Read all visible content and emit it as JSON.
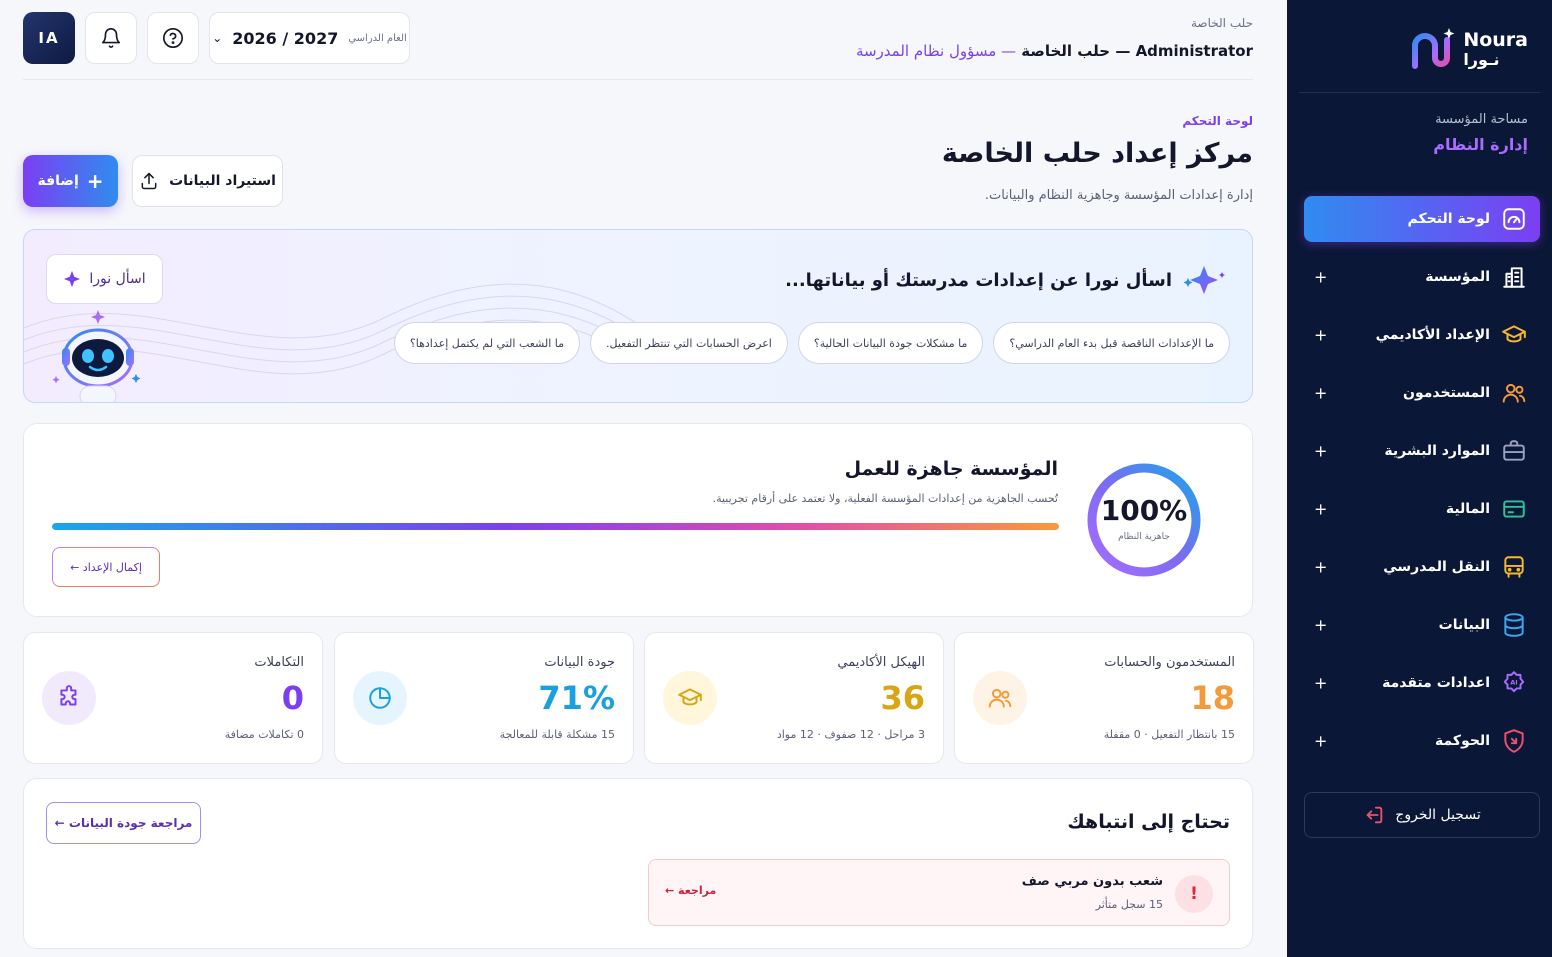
{
  "brand": {
    "name_en": "Noura",
    "name_ar": "نـورا"
  },
  "sidebar": {
    "workspace_label": "مساحة المؤسسة",
    "workspace_value": "إدارة النظام",
    "items": [
      {
        "label": "لوحة التحكم",
        "icon": "dashboard-gauge-icon",
        "color": "#ffffff",
        "active": true
      },
      {
        "label": "المؤسسة",
        "icon": "building-icon",
        "color": "#ffffff",
        "plus": "+"
      },
      {
        "label": "الإعداد الأكاديمي",
        "icon": "graduation-cap-icon",
        "color": "#f5b92a",
        "plus": "+"
      },
      {
        "label": "المستخدمون",
        "icon": "users-icon",
        "color": "#f59a3a",
        "plus": "+"
      },
      {
        "label": "الموارد البشرية",
        "icon": "briefcase-icon",
        "color": "#9aa3bd",
        "plus": "+"
      },
      {
        "label": "المالية",
        "icon": "credit-card-icon",
        "color": "#2fc39a",
        "plus": "+"
      },
      {
        "label": "النقل المدرسي",
        "icon": "bus-icon",
        "color": "#f5b92a",
        "plus": "+"
      },
      {
        "label": "البيانات",
        "icon": "database-icon",
        "color": "#3aa7f0",
        "plus": "+"
      },
      {
        "label": "اعدادات متقدمة",
        "icon": "ai-badge-icon",
        "color": "#a86cff",
        "plus": "+"
      },
      {
        "label": "الحوكمة",
        "icon": "shield-icon",
        "color": "#f0506e",
        "plus": "+"
      }
    ],
    "logout_label": "تسجيل الخروج"
  },
  "topbar": {
    "avatar_initials": "IA",
    "year_label": "العام الدراسي",
    "year_value": "2026 / 2027",
    "org_small": "حلب الخاصة",
    "org_name": "Administrator — حلب الخاصة",
    "org_role": "— مسؤول نظام المدرسة"
  },
  "page": {
    "breadcrumb": "لوحة التحكم",
    "title": "مركز إعداد حلب الخاصة",
    "subtitle": "إدارة إعدادات المؤسسة وجاهزية النظام والبيانات.",
    "add_label": "إضافة",
    "import_label": "استيراد البيانات"
  },
  "ask": {
    "title": "اسأل نورا عن إعدادات مدرستك أو بياناتها...",
    "button_label": "اسأل نورا",
    "chips": [
      "ما الإعدادات الناقصة قبل بدء العام الدراسي؟",
      "ما مشكلات جودة البيانات الحالية؟",
      "اعرض الحسابات التي تنتظر التفعيل.",
      "ما الشعب التي لم يكتمل إعدادها؟"
    ]
  },
  "readiness": {
    "percent_text": "100%",
    "percent_value": 100,
    "ring_label": "جاهزية النظام",
    "title": "المؤسسة جاهزة للعمل",
    "subtitle": "تُحسب الجاهزية من إعدادات المؤسسة الفعلية، ولا تعتمد على أرقام تجريبية.",
    "progress_value": 1.0,
    "button_label": "إكمال الإعداد ←"
  },
  "stats": [
    {
      "title": "المستخدمون والحسابات",
      "value": "18",
      "note": "15 بانتظار التفعيل · 0 مقفلة",
      "color": "#f59a3a",
      "bg": "#fff3e6",
      "icon": "users-icon"
    },
    {
      "title": "الهيكل الأكاديمي",
      "value": "36",
      "note": "3 مراحل · 12 صفوف · 12 مواد",
      "color": "#d9a514",
      "bg": "#fff6dc",
      "icon": "graduation-cap-icon"
    },
    {
      "title": "جودة البيانات",
      "value": "71%",
      "note": "15 مشكلة قابلة للمعالجة",
      "color": "#1a9fe0",
      "bg": "#e6f5fd",
      "icon": "pie-chart-icon"
    },
    {
      "title": "التكاملات",
      "value": "0",
      "note": "0 تكاملات مضافة",
      "color": "#7b3ff2",
      "bg": "#f1eafd",
      "icon": "puzzle-icon"
    }
  ],
  "attention": {
    "title": "تحتاج إلى انتباهك",
    "button_label": "مراجعة جودة البيانات ←",
    "alert_icon": "!",
    "alert_title": "شعب بدون مربي صف",
    "alert_sub": "15 سجل متأثر",
    "alert_link": "مراجعة ←"
  }
}
